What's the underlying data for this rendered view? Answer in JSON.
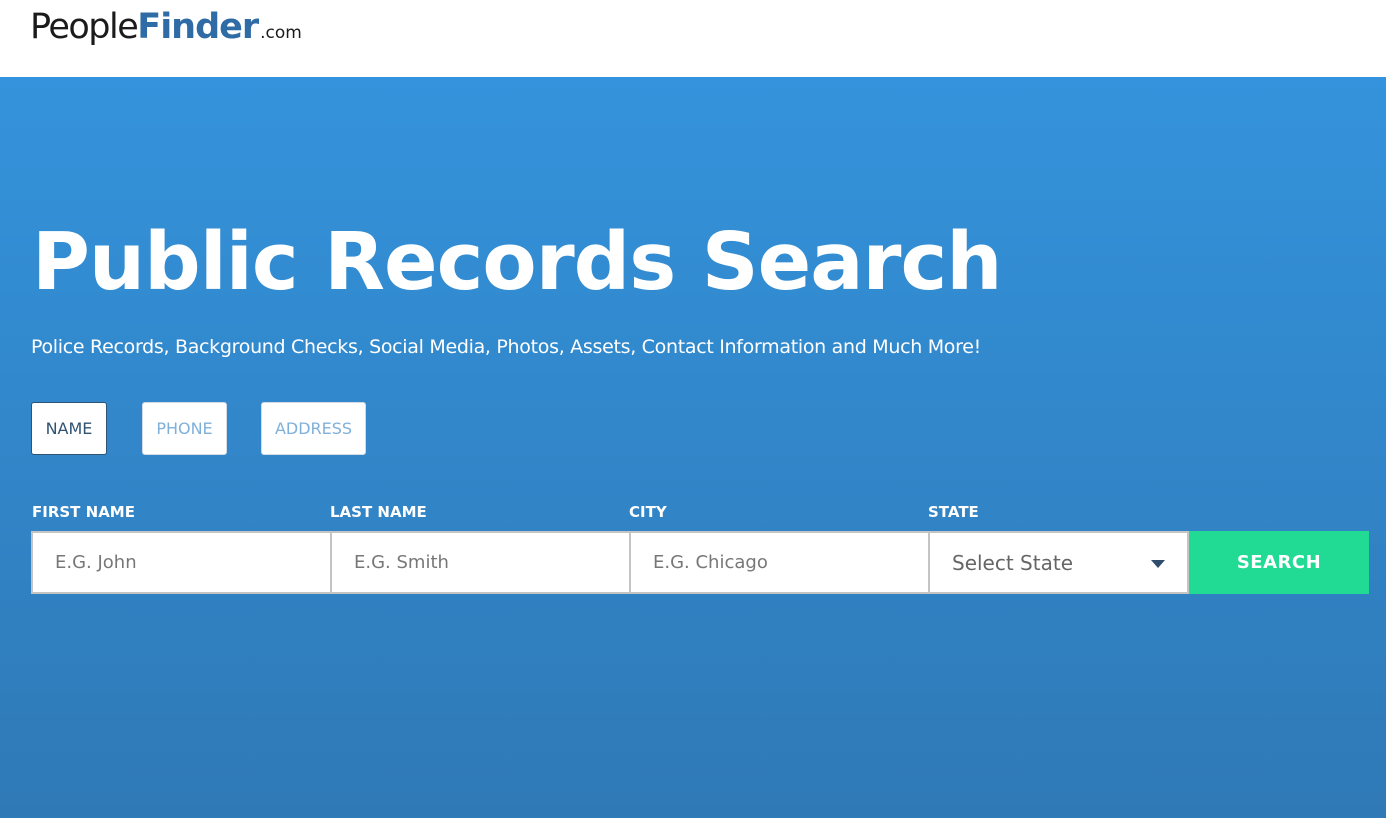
{
  "header": {
    "logo": {
      "part1": "People",
      "part2": "Finder",
      "part3": ".com"
    }
  },
  "hero": {
    "title": "Public Records Search",
    "subtitle": "Police Records, Background Checks, Social Media, Photos, Assets, Contact Information and Much More!"
  },
  "tabs": [
    {
      "label": "NAME",
      "active": true
    },
    {
      "label": "PHONE",
      "active": false
    },
    {
      "label": "ADDRESS",
      "active": false
    }
  ],
  "form": {
    "first_name": {
      "label": "FIRST NAME",
      "placeholder": "E.G. John",
      "value": ""
    },
    "last_name": {
      "label": "LAST NAME",
      "placeholder": "E.G. Smith",
      "value": ""
    },
    "city": {
      "label": "CITY",
      "placeholder": "E.G. Chicago",
      "value": ""
    },
    "state": {
      "label": "STATE",
      "selected": "Select State"
    },
    "search_label": "SEARCH"
  },
  "colors": {
    "hero_top": "#3493dc",
    "hero_bottom": "#2f79b6",
    "logo_accent": "#2f6ca6",
    "search_button": "#21da93",
    "active_tab": "#2f5373",
    "inactive_tab_text": "#7fb0da"
  },
  "icons": {
    "state_dropdown": "chevron-down-icon"
  }
}
